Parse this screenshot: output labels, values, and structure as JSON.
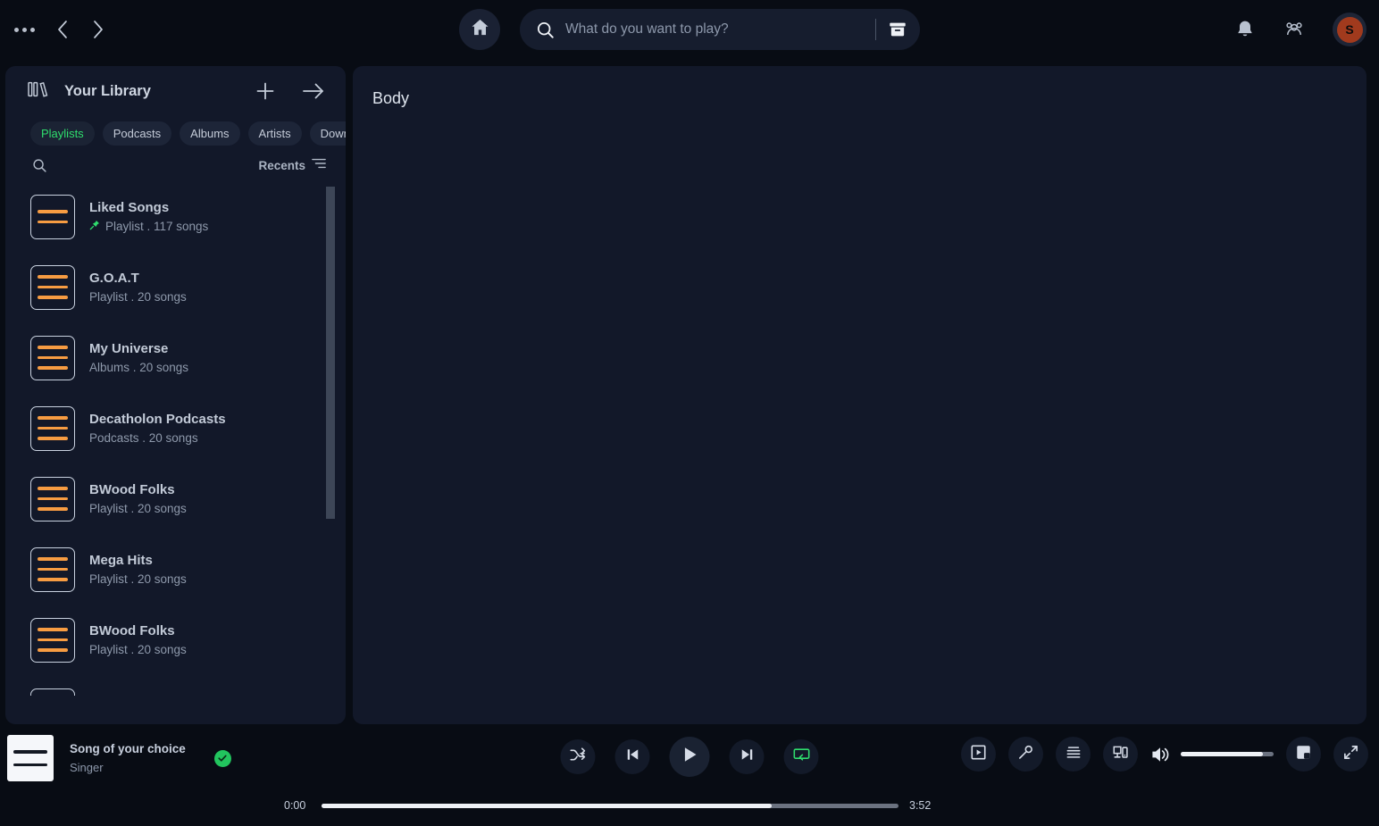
{
  "topbar": {
    "menu_icon": "more-horizontal-icon",
    "back_icon": "chevron-left-icon",
    "forward_icon": "chevron-right-icon",
    "home_icon": "home-icon",
    "search_icon": "search-icon",
    "browse_icon": "browse-box-icon",
    "notifications_icon": "bell-icon",
    "friends_icon": "friend-activity-icon",
    "search": {
      "value": "",
      "placeholder": "What do you want to play?"
    },
    "avatar": {
      "initial": "S",
      "color": "#a13a1d"
    }
  },
  "sidebar": {
    "title": "Your Library",
    "library_icon": "library-books-icon",
    "add_icon": "plus-icon",
    "expand_icon": "arrow-right-icon",
    "search_icon": "search-icon",
    "sort_label": "Recents",
    "sort_icon": "list-order-icon",
    "filters": [
      {
        "label": "Playlists",
        "active": true
      },
      {
        "label": "Podcasts",
        "active": false
      },
      {
        "label": "Albums",
        "active": false
      },
      {
        "label": "Artists",
        "active": false
      },
      {
        "label": "Downloaded",
        "active": false
      }
    ],
    "items": [
      {
        "name": "Liked Songs",
        "type": "Playlist",
        "count": "117 songs",
        "sub": "Playlist . 117 songs",
        "pinned": true,
        "bars": 2
      },
      {
        "name": "G.O.A.T",
        "type": "Playlist",
        "count": "20 songs",
        "sub": "Playlist . 20 songs",
        "pinned": false,
        "bars": 3
      },
      {
        "name": "My Universe",
        "type": "Albums",
        "count": "20 songs",
        "sub": "Albums . 20 songs",
        "pinned": false,
        "bars": 3
      },
      {
        "name": "Decatholon Podcasts",
        "type": "Podcasts",
        "count": "20 songs",
        "sub": "Podcasts . 20 songs",
        "pinned": false,
        "bars": 3
      },
      {
        "name": "BWood Folks",
        "type": "Playlist",
        "count": "20 songs",
        "sub": "Playlist . 20 songs",
        "pinned": false,
        "bars": 3
      },
      {
        "name": "Mega Hits",
        "type": "Playlist",
        "count": "20 songs",
        "sub": "Playlist . 20 songs",
        "pinned": false,
        "bars": 3
      },
      {
        "name": "BWood Folks",
        "type": "Playlist",
        "count": "20 songs",
        "sub": "Playlist . 20 songs",
        "pinned": false,
        "bars": 3
      }
    ],
    "accent_green": "#2fdd6d",
    "thumb_bar_color": "#f79c42"
  },
  "main": {
    "title": "Body"
  },
  "player": {
    "track_title": "Song of your choice",
    "artist": "Singer",
    "saved_icon": "check-circle-icon",
    "shuffle_icon": "shuffle-icon",
    "previous_icon": "skip-previous-icon",
    "play_icon": "play-icon",
    "next_icon": "skip-next-icon",
    "repeat_icon": "repeat-icon",
    "elapsed": "0:00",
    "duration": "3:52",
    "progress_percent": 78,
    "now_playing_view_icon": "now-playing-view-icon",
    "lyrics_icon": "microphone-lyrics-icon",
    "queue_icon": "queue-list-icon",
    "devices_icon": "connect-device-icon",
    "volume_icon": "volume-high-icon",
    "volume_percent": 88,
    "miniplayer_icon": "mini-player-icon",
    "fullscreen_icon": "fullscreen-icon"
  }
}
